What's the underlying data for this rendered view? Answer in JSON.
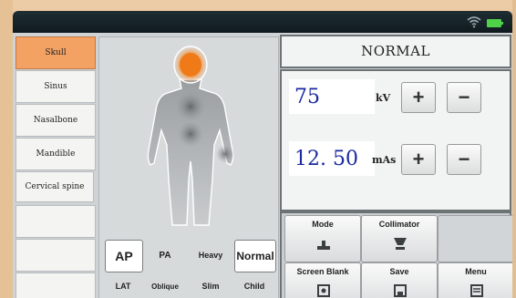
{
  "body_parts": [
    "Skull",
    "Sinus",
    "Nasalbone",
    "Mandible",
    "Cervical spine",
    "",
    "",
    ""
  ],
  "active_body_part": "Skull",
  "positions": {
    "row1": [
      "AP",
      "PA",
      "Heavy",
      "Normal"
    ],
    "row2": [
      "LAT",
      "Oblique",
      "Slim",
      "Child"
    ]
  },
  "mode_title": "NORMAL",
  "kv": {
    "value": "75",
    "unit": "kV"
  },
  "mas": {
    "value": "12. 50",
    "unit": "mAs"
  },
  "step_labels": {
    "plus": "+",
    "minus": "−"
  },
  "functions": {
    "mode": "Mode",
    "collimator": "Collimator",
    "screen_blank": "Screen Blank",
    "save": "Save",
    "menu": "Menu"
  },
  "colors": {
    "accent": "#f4a264",
    "value_text": "#1a2aa0",
    "status_bar": "#16242a",
    "battery": "#4fd14a"
  },
  "icons": [
    "wifi-icon",
    "battery-icon",
    "mode-icon",
    "collimator-icon",
    "screen-blank-icon",
    "save-icon",
    "menu-icon"
  ]
}
